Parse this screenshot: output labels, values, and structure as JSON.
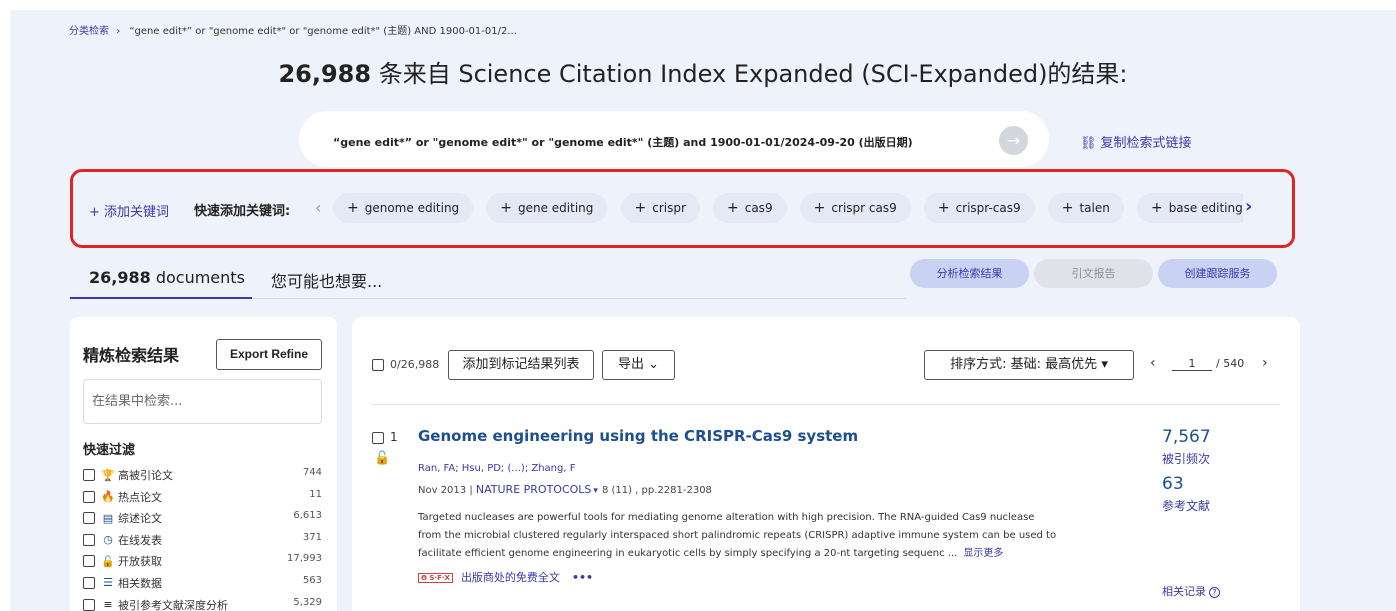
{
  "breadcrumb": {
    "link": "分类检索",
    "separator": "›",
    "query": "“gene edit*” or \"genome edit*\" or \"genome edit*\" (主题) AND 1900-01-01/2..."
  },
  "header": {
    "count": "26,988",
    "suffix": " 条来自 Science Citation Index Expanded (SCI-Expanded)的结果:"
  },
  "query": {
    "text": "“gene edit*” or \"genome edit*\" or \"genome edit*\" (主题) and 1900-01-01/2024-09-20 (出版日期)",
    "go_icon": "arrow-right-icon",
    "copy_icon": "link-icon",
    "copy_label": "复制检索式链接"
  },
  "keywords": {
    "add_label": "+ 添加关键词",
    "quick_label": "快速添加关键词:",
    "prev_icon": "‹",
    "next_icon": "›",
    "chips": [
      "genome editing",
      "gene editing",
      "crispr",
      "cas9",
      "crispr cas9",
      "crispr-cas9",
      "talen",
      "base editing",
      ""
    ]
  },
  "tabs": {
    "docs_count": "26,988",
    "docs_label": " documents",
    "suggest_label": "您可能也想要..."
  },
  "actions": {
    "analyze": "分析检索结果",
    "citation_report": "引文报告",
    "create_alert": "创建跟踪服务"
  },
  "refine": {
    "title": "精炼检索结果",
    "export": "Export Refine",
    "search_placeholder": "在结果中检索...",
    "quick_filter_title": "快速过滤",
    "filters": [
      {
        "icon": "trophy-icon",
        "glyph": "🏆",
        "color": "#c0392b",
        "label": "高被引论文",
        "count": "744"
      },
      {
        "icon": "flame-icon",
        "glyph": "🔥",
        "color": "#c0392b",
        "label": "热点论文",
        "count": "11"
      },
      {
        "icon": "document-icon",
        "glyph": "▤",
        "color": "#1d4f91",
        "label": "综述论文",
        "count": "6,613"
      },
      {
        "icon": "clock-icon",
        "glyph": "◷",
        "color": "#1d4f91",
        "label": "在线发表",
        "count": "371"
      },
      {
        "icon": "unlock-icon",
        "glyph": "🔓",
        "color": "#222222",
        "label": "开放获取",
        "count": "17,993"
      },
      {
        "icon": "database-icon",
        "glyph": "☰",
        "color": "#1d4f91",
        "label": "相关数据",
        "count": "563"
      },
      {
        "icon": "list-star-icon",
        "glyph": "≡",
        "color": "#222222",
        "label": "被引参考文献深度分析",
        "count": "5,329"
      }
    ]
  },
  "results_toolbar": {
    "select_count": "0/26,988",
    "add_to_marked": "添加到标记结果列表",
    "export": "导出",
    "export_caret": "⌄",
    "sort": "排序方式: 基础: 最高优先",
    "sort_caret": "▾",
    "page_prev": "‹",
    "page_current": "1",
    "page_total": "/ 540",
    "page_next": "›"
  },
  "record": {
    "index": "1",
    "title": "Genome engineering using the CRISPR-Cas9 system",
    "authors": "Ran, FA; Hsu, PD; (...); Zhang, F",
    "date": "Nov 2013 | ",
    "journal": "NATURE PROTOCOLS",
    "journal_caret": "▾",
    "volume": "8 (11) , pp.2281-2308",
    "abstract": "Targeted nucleases are powerful tools for mediating genome alteration with high precision. The RNA-guided Cas9 nuclease from the microbial clustered regularly interspaced short palindromic repeats (CRISPR) adaptive immune system can be used to facilitate efficient genome engineering in eukaryotic cells by simply specifying a 20-nt targeting sequenc ...",
    "show_more": "显示更多",
    "sfx_badge": "Θ S·F·X",
    "fulltext": "出版商处的免费全文",
    "more_dots": "•••",
    "times_cited": "7,567",
    "times_cited_label": "被引频次",
    "references": "63",
    "references_label": "参考文献",
    "related": "相关记录"
  },
  "colors": {
    "accent": "#3a3aa8",
    "title_blue": "#1d4f91",
    "highlight_border": "#e02424",
    "page_bg": "#eef3fb"
  }
}
